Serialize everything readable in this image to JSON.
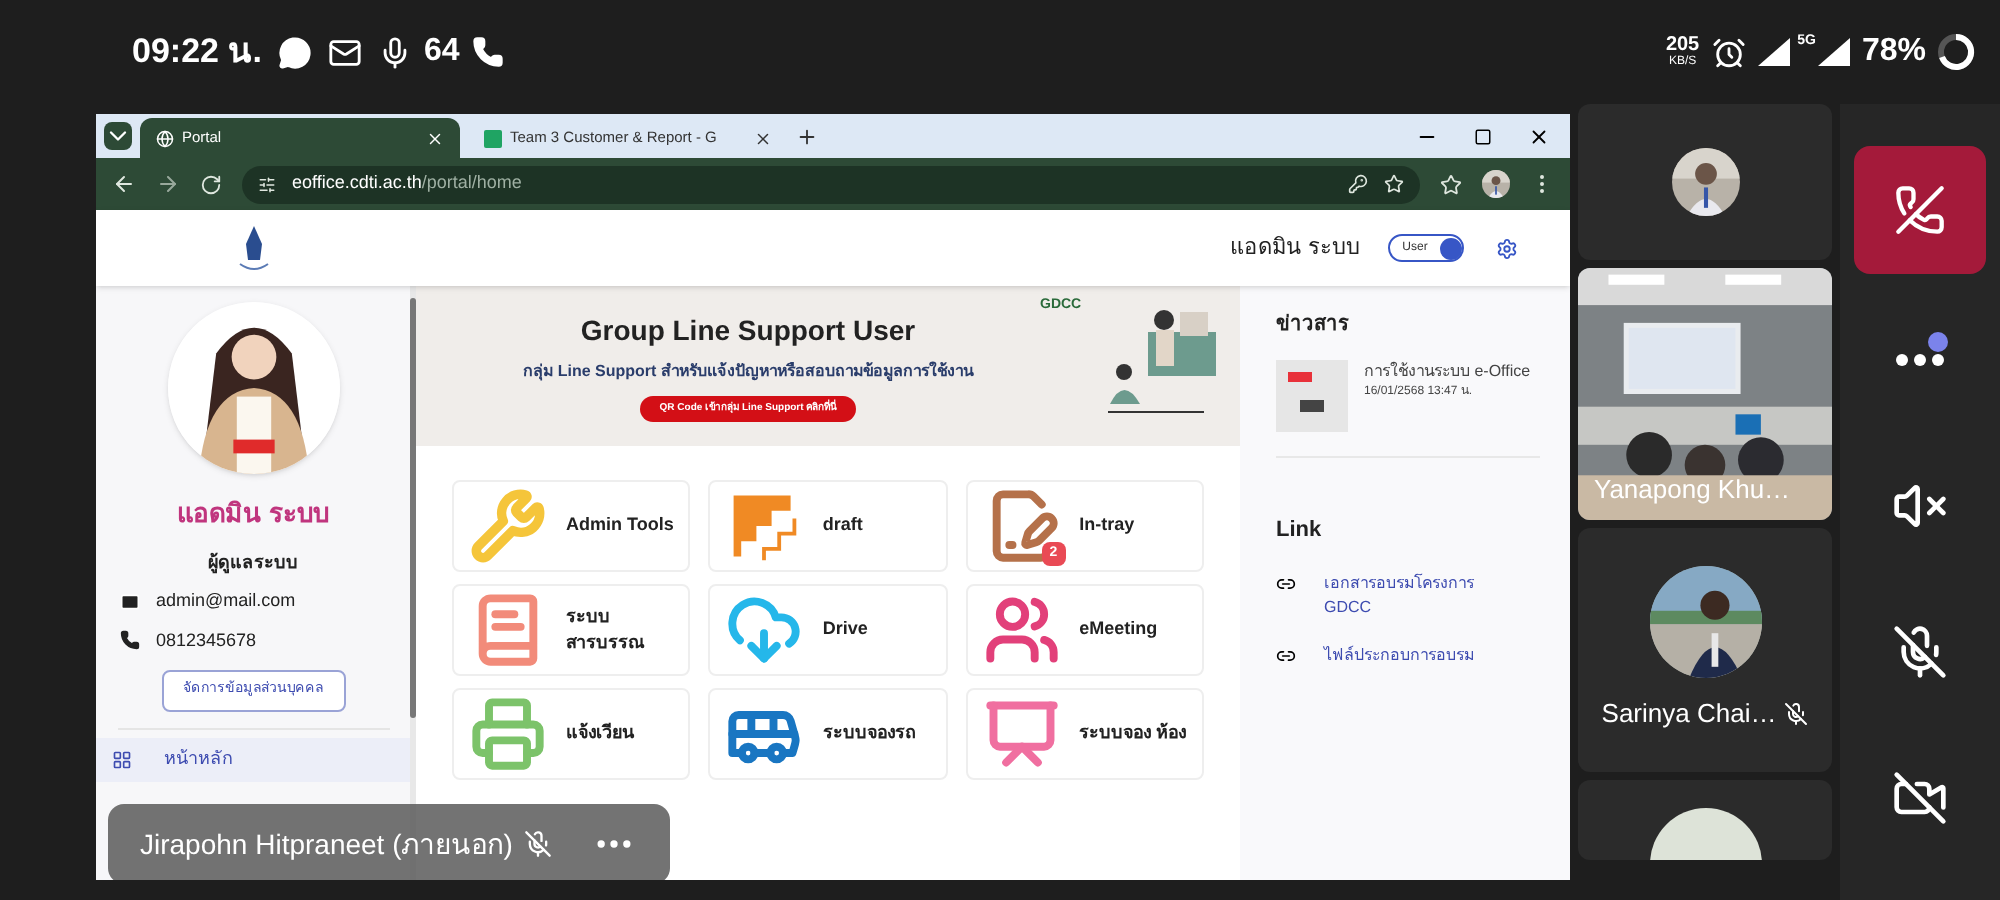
{
  "status_bar": {
    "time": "09:22 น.",
    "count": "64",
    "speed": "205",
    "speed_unit": "KB/S",
    "network": "5G",
    "battery": "78%"
  },
  "browser": {
    "tabs": [
      {
        "title": "Portal",
        "selected": true
      },
      {
        "title": "Team 3 Customer & Report - G",
        "selected": false
      }
    ],
    "url_host": "eoffice.cdti.ac.th",
    "url_path": "/portal/home"
  },
  "header": {
    "user_name": "แอดมิน ระบบ",
    "mode_toggle": {
      "label": "User",
      "on": true
    }
  },
  "profile": {
    "name": "แอดมิน ระบบ",
    "role": "ผู้ดูแลระบบ",
    "email": "admin@mail.com",
    "phone": "0812345678",
    "edit_button": "จัดการข้อมูลส่วนบุคคล"
  },
  "sidebar": {
    "items": [
      {
        "label": "หน้าหลัก",
        "selected": true
      }
    ]
  },
  "banner": {
    "logo": "GDCC",
    "title": "Group Line Support User",
    "subtitle": "กลุ่ม Line Support สำหรับแจ้งปัญหาหรือสอบถามข้อมูลการใช้งาน",
    "button": "QR Code เข้ากลุ่ม Line Support คลิกที่นี่"
  },
  "apps": [
    {
      "label": "Admin Tools",
      "kind": "tools"
    },
    {
      "label": "draft",
      "kind": "stairs"
    },
    {
      "label": "In-tray",
      "kind": "signature",
      "badge": "2"
    },
    {
      "label": "ระบบ สารบรรณ",
      "kind": "book"
    },
    {
      "label": "Drive",
      "kind": "cloud"
    },
    {
      "label": "eMeeting",
      "kind": "people"
    },
    {
      "label": "แจ้งเวียน",
      "kind": "fax"
    },
    {
      "label": "ระบบจองรถ",
      "kind": "bus"
    },
    {
      "label": "ระบบจอง ห้อง",
      "kind": "room"
    }
  ],
  "news": {
    "heading": "ข่าวสาร",
    "items": [
      {
        "title": "การใช้งานระบบ e-Office",
        "date": "16/01/2568 13:47 น."
      }
    ]
  },
  "links": {
    "heading": "Link",
    "items": [
      "เอกสารอบรมโครงการ GDCC",
      "ไฟล์ประกอบการอบรม"
    ]
  },
  "presenter": {
    "name": "Jirapohn Hitpraneet (ภายนอก)",
    "muted": true
  },
  "participants": [
    {
      "kind": "avatar"
    },
    {
      "kind": "video",
      "name": "Yanapong Khu…",
      "muted": false
    },
    {
      "kind": "avatar",
      "name": "Sarinya Chai…",
      "muted": true
    },
    {
      "kind": "avatar"
    }
  ],
  "controls": [
    {
      "kind": "hangup"
    },
    {
      "kind": "more",
      "notification": true
    },
    {
      "kind": "speaker",
      "on": false
    },
    {
      "kind": "mic",
      "on": false
    },
    {
      "kind": "camera",
      "on": false
    }
  ]
}
